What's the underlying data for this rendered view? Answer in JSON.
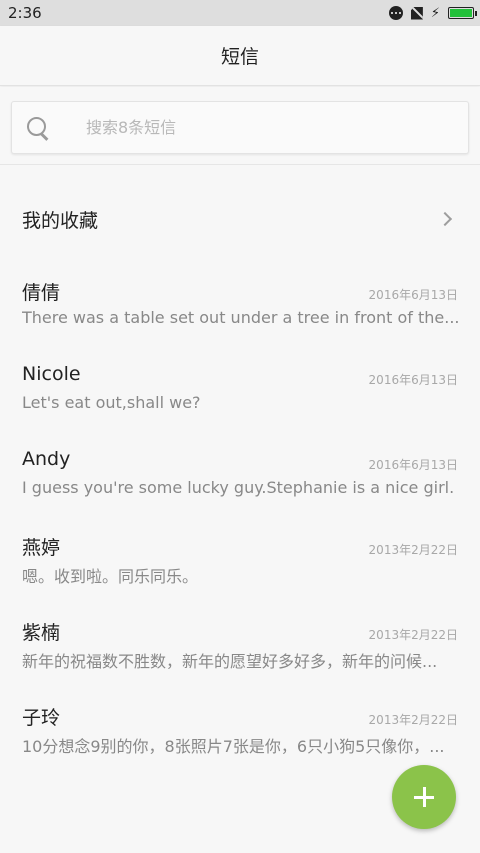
{
  "status_bar": {
    "time": "2:36",
    "icons": [
      "more-dots-icon",
      "no-sim-icon",
      "charging-bolt-icon",
      "battery-icon"
    ],
    "battery_color": "#22c13a"
  },
  "header": {
    "title": "短信"
  },
  "search": {
    "placeholder": "搜索8条短信",
    "value": ""
  },
  "favorites": {
    "label": "我的收藏"
  },
  "messages": [
    {
      "name": "倩倩",
      "date": "2016年6月13日",
      "preview": "There was a table set out under a tree in front of the..."
    },
    {
      "name": "Nicole",
      "date": "2016年6月13日",
      "preview": "Let's eat out,shall we?"
    },
    {
      "name": "Andy",
      "date": "2016年6月13日",
      "preview": "I guess you're some lucky guy.Stephanie is a nice girl."
    },
    {
      "name": "燕婷",
      "date": "2013年2月22日",
      "preview": "嗯。收到啦。同乐同乐。"
    },
    {
      "name": "紫楠",
      "date": "2013年2月22日",
      "preview": "新年的祝福数不胜数，新年的愿望好多好多，新年的问候..."
    },
    {
      "name": "子玲",
      "date": "2013年2月22日",
      "preview": "10分想念9别的你，8张照片7张是你，6只小狗5只像你，..."
    }
  ],
  "fab": {
    "icon": "plus-icon",
    "color": "#8bc34a"
  }
}
